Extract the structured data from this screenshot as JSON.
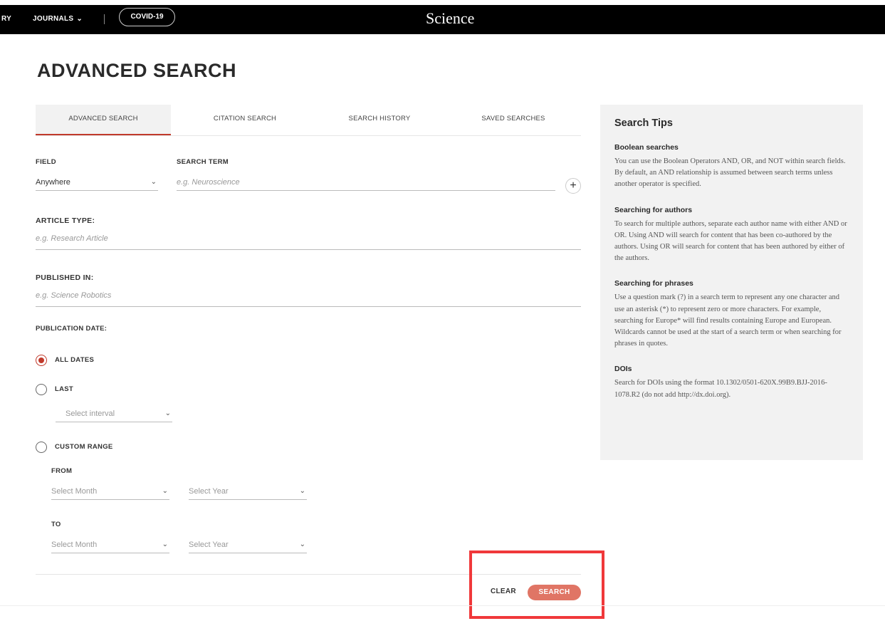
{
  "topnav": {
    "cut_item": "RY",
    "journals_label": "JOURNALS",
    "covid_label": "COVID-19",
    "brand": "Science"
  },
  "page": {
    "title": "ADVANCED SEARCH"
  },
  "tabs": [
    {
      "label": "ADVANCED SEARCH",
      "active": true
    },
    {
      "label": "CITATION SEARCH",
      "active": false
    },
    {
      "label": "SEARCH HISTORY",
      "active": false
    },
    {
      "label": "SAVED SEARCHES",
      "active": false
    }
  ],
  "form": {
    "field_label": "FIELD",
    "field_value": "Anywhere",
    "search_term_label": "SEARCH TERM",
    "search_term_placeholder": "e.g. Neuroscience",
    "add_row": "+",
    "article_type_label": "ARTICLE TYPE:",
    "article_type_placeholder": "e.g. Research Article",
    "published_in_label": "PUBLISHED IN:",
    "published_in_placeholder": "e.g. Science Robotics",
    "publication_date_label": "PUBLICATION DATE:",
    "options": {
      "all_dates": "ALL DATES",
      "last": "LAST",
      "custom_range": "CUSTOM RANGE"
    },
    "selected_option": "all_dates",
    "interval_placeholder": "Select interval",
    "from_label": "FROM",
    "to_label": "TO",
    "month_placeholder": "Select Month",
    "year_placeholder": "Select Year"
  },
  "actions": {
    "clear": "CLEAR",
    "search": "SEARCH"
  },
  "tips": {
    "title": "Search Tips",
    "sections": [
      {
        "heading": "Boolean searches",
        "body": "You can use the Boolean Operators AND, OR, and NOT within search fields. By default, an AND relationship is assumed between search terms unless another operator is specified."
      },
      {
        "heading": "Searching for authors",
        "body": "To search for multiple authors, separate each author name with either AND or OR. Using AND will search for content that has been co-authored by the authors. Using OR will search for content that has been authored by either of the authors."
      },
      {
        "heading": "Searching for phrases",
        "body": "Use a question mark (?) in a search term to represent any one character and use an asterisk (*) to represent zero or more characters. For example, searching for Europe* will find results containing Europe and European. Wildcards cannot be used at the start of a search term or when searching for phrases in quotes."
      },
      {
        "heading": "DOIs",
        "body": "Search for DOIs using the format 10.1302/0501-620X.99B9.BJJ-2016-1078.R2 (do not add http://dx.doi.org)."
      }
    ]
  },
  "colors": {
    "accent": "#c0392b",
    "search_button": "#e07565",
    "highlight": "#f0383a"
  },
  "icons": {
    "dropdown": "chevron-down-icon",
    "add": "plus-icon"
  }
}
